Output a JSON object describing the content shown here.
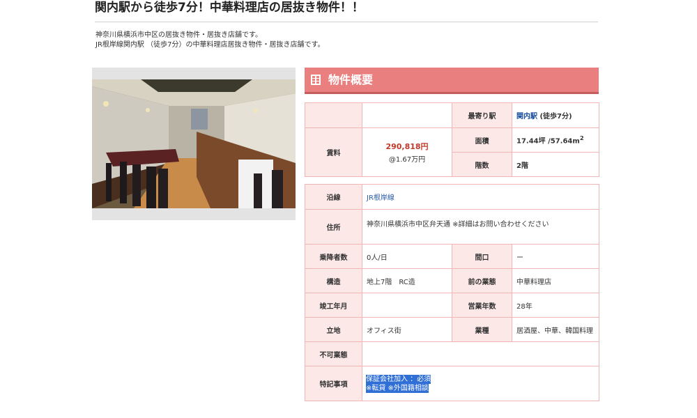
{
  "page": {
    "title": "関内駅から徒歩7分！中華料理店の居抜き物件！！",
    "desc_line1": "神奈川県横浜市中区の居抜き物件・居抜き店舗です。",
    "desc_line2": "JR根岸線関内駅 （徒歩7分）の中華料理店居抜き物件・居抜き店舗です。"
  },
  "section": {
    "title": "物件概要",
    "icon": "grid-icon"
  },
  "summary": {
    "rent_label": "賃料",
    "rent_value": "290,818円",
    "rent_per_tsubo": "@1.67万円",
    "station_label": "最寄り駅",
    "station_name": "関内駅",
    "station_walk": " (徒歩7分)",
    "area_label": "面積",
    "area_value": "17.44坪 /57.64m",
    "area_sup": "2",
    "floor_label": "階数",
    "floor_value": "2階"
  },
  "details": {
    "line_label": "沿線",
    "line_value": "JR根岸線",
    "address_label": "住所",
    "address_value": "神奈川県横浜市中区弁天通 ※詳細はお問い合わせください",
    "passengers_label": "乗降者数",
    "passengers_value": "0人/日",
    "frontage_label": "間口",
    "frontage_value": "ー",
    "structure_label": "構造",
    "structure_value": "地上7階　RC造",
    "prev_business_label": "前の業態",
    "prev_business_value": "中華料理店",
    "built_label": "竣工年月",
    "built_value": "",
    "years_label": "営業年数",
    "years_value": "28年",
    "location_label": "立地",
    "location_value": "オフィス街",
    "type_label": "業種",
    "type_value": "居酒屋、中華、韓国料理",
    "prohibited_label": "不可業態",
    "prohibited_value": "",
    "notes_label": "特記事項",
    "notes_line1": "保証会社加入 ：必須",
    "notes_line2": "※転貸 ※外国籍相談"
  },
  "colors": {
    "header_bg": "#ea7f7f",
    "label_bg": "#fde8e8",
    "border": "#f2b5b5",
    "price": "#c0392b",
    "link": "#1a4f9c",
    "selection": "#2f6fd6"
  }
}
